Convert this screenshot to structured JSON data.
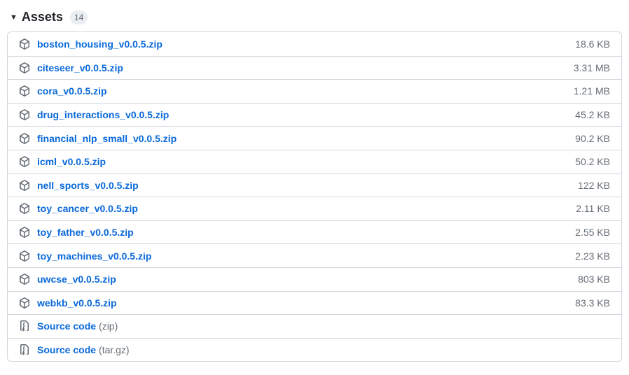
{
  "header": {
    "title": "Assets",
    "count": "14"
  },
  "assets": [
    {
      "icon": "package",
      "name": "boston_housing_v0.0.5.zip",
      "size": "18.6 KB"
    },
    {
      "icon": "package",
      "name": "citeseer_v0.0.5.zip",
      "size": "3.31 MB"
    },
    {
      "icon": "package",
      "name": "cora_v0.0.5.zip",
      "size": "1.21 MB"
    },
    {
      "icon": "package",
      "name": "drug_interactions_v0.0.5.zip",
      "size": "45.2 KB"
    },
    {
      "icon": "package",
      "name": "financial_nlp_small_v0.0.5.zip",
      "size": "90.2 KB"
    },
    {
      "icon": "package",
      "name": "icml_v0.0.5.zip",
      "size": "50.2 KB"
    },
    {
      "icon": "package",
      "name": "nell_sports_v0.0.5.zip",
      "size": "122 KB"
    },
    {
      "icon": "package",
      "name": "toy_cancer_v0.0.5.zip",
      "size": "2.11 KB"
    },
    {
      "icon": "package",
      "name": "toy_father_v0.0.5.zip",
      "size": "2.55 KB"
    },
    {
      "icon": "package",
      "name": "toy_machines_v0.0.5.zip",
      "size": "2.23 KB"
    },
    {
      "icon": "package",
      "name": "uwcse_v0.0.5.zip",
      "size": "803 KB"
    },
    {
      "icon": "package",
      "name": "webkb_v0.0.5.zip",
      "size": "83.3 KB"
    },
    {
      "icon": "zip",
      "name": "Source code",
      "suffix": "(zip)",
      "size": ""
    },
    {
      "icon": "zip",
      "name": "Source code",
      "suffix": "(tar.gz)",
      "size": ""
    }
  ]
}
